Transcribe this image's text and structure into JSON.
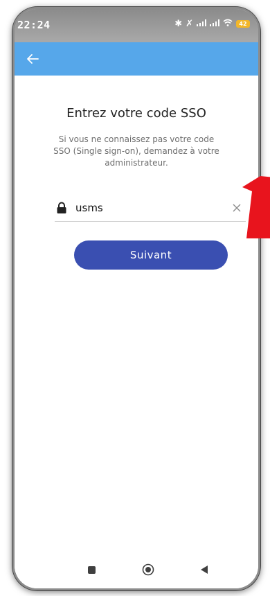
{
  "status_bar": {
    "time": "22:24",
    "battery": "42"
  },
  "icons": {
    "back": "arrow-left-icon",
    "lock": "lock-icon",
    "clear": "close-icon",
    "bluetooth": "bluetooth-icon",
    "signal": "signal-icon",
    "wifi": "wifi-icon",
    "battery": "battery-icon"
  },
  "colors": {
    "app_bar": "#56a7ea",
    "primary_button": "#3a4fb1",
    "annotation_arrow": "#e8141d"
  },
  "sso": {
    "title": "Entrez votre code SSO",
    "description": "Si vous ne connaissez pas votre code SSO (Single sign-on), demandez à votre administrateur.",
    "code_value": "usms",
    "next_label": "Suivant"
  }
}
